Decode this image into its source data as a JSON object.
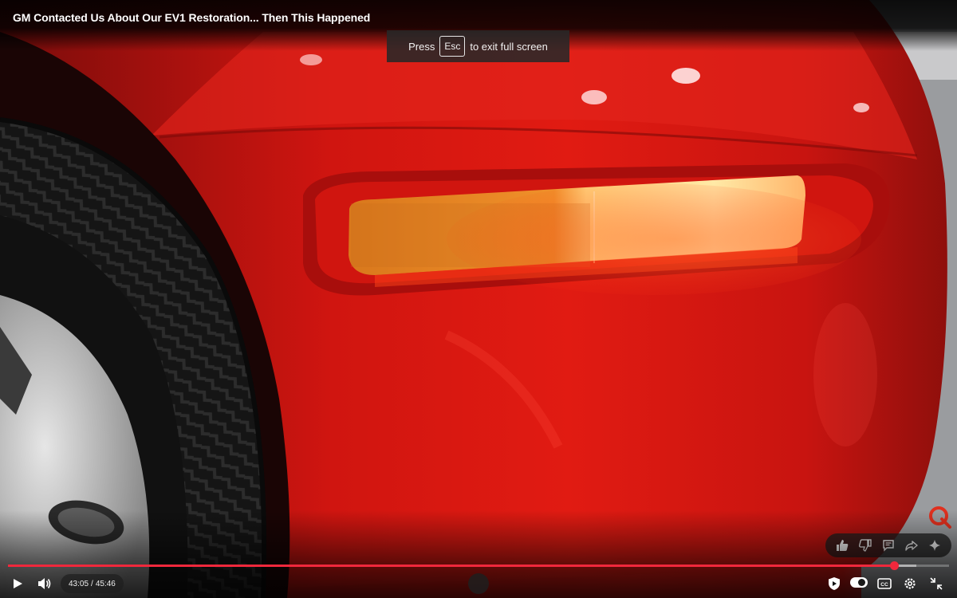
{
  "video": {
    "title": "GM Contacted Us About Our EV1 Restoration... Then This Happened"
  },
  "fullscreen_hint": {
    "prefix": "Press",
    "key": "Esc",
    "suffix": "to exit full screen"
  },
  "player": {
    "current_time": "43:05",
    "duration": "45:46",
    "time_separator": "/",
    "progress_fraction": 0.9417,
    "buffered_fraction": 0.965,
    "autoplay_on": true,
    "accent_color": "#f0283c"
  },
  "action_pill": {
    "icons": [
      "like-icon",
      "dislike-icon",
      "comments-icon",
      "share-icon",
      "sparkle-icon"
    ]
  },
  "controls": {
    "left_icons": [
      "play-icon",
      "volume-icon"
    ],
    "right_icons": [
      "shield-icon",
      "autoplay-toggle",
      "captions-icon",
      "settings-icon",
      "exit-fullscreen-icon"
    ]
  },
  "watermark": {
    "icon": "q-logo-icon",
    "color": "#e0301e"
  }
}
